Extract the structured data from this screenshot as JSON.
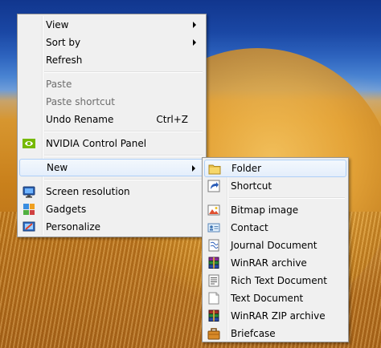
{
  "main_menu": {
    "view": "View",
    "sort_by": "Sort by",
    "refresh": "Refresh",
    "paste": "Paste",
    "paste_shortcut": "Paste shortcut",
    "undo_rename": "Undo Rename",
    "undo_rename_shortcut": "Ctrl+Z",
    "nvidia": "NVIDIA Control Panel",
    "new": "New",
    "screen_resolution": "Screen resolution",
    "gadgets": "Gadgets",
    "personalize": "Personalize"
  },
  "new_submenu": {
    "folder": "Folder",
    "shortcut": "Shortcut",
    "bitmap": "Bitmap image",
    "contact": "Contact",
    "journal": "Journal Document",
    "winrar": "WinRAR archive",
    "rtf": "Rich Text Document",
    "text": "Text Document",
    "winrar_zip": "WinRAR ZIP archive",
    "briefcase": "Briefcase"
  },
  "icons": {
    "nvidia": "nvidia-icon",
    "screen_resolution": "monitor-icon",
    "gadgets": "gadgets-icon",
    "personalize": "personalize-icon",
    "folder": "folder-icon",
    "shortcut": "shortcut-arrow-icon",
    "bitmap": "bitmap-icon",
    "contact": "contact-card-icon",
    "journal": "journal-icon",
    "winrar": "winrar-books-icon",
    "rtf": "rtf-document-icon",
    "text": "text-document-icon",
    "winrar_zip": "winrar-zip-icon",
    "briefcase": "briefcase-icon"
  },
  "colors": {
    "menu_bg": "#f0f0f0",
    "highlight_border": "#aecff7",
    "disabled_text": "#6d6d6d"
  }
}
